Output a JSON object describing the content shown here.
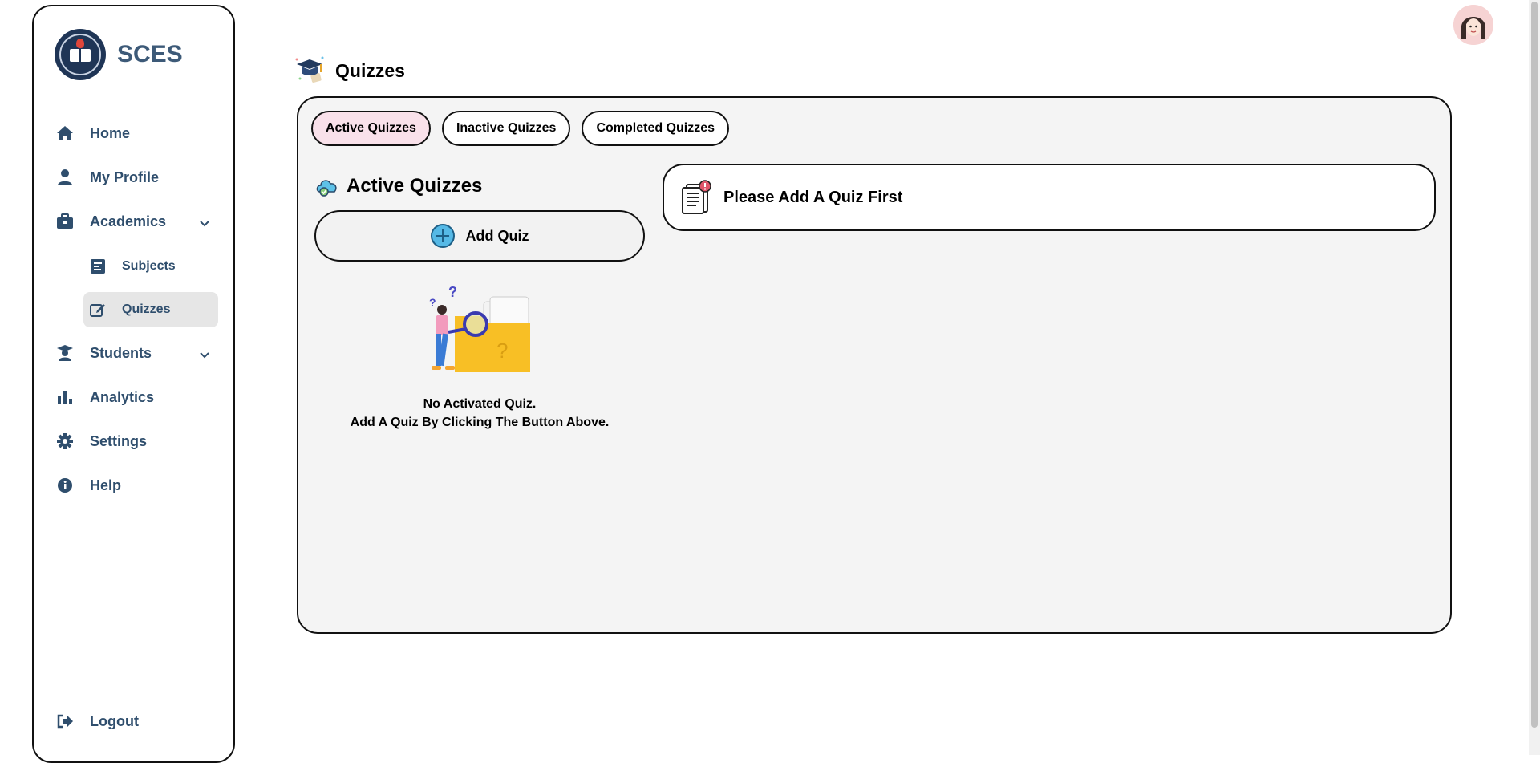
{
  "brand": {
    "name": "SCES"
  },
  "sidebar": {
    "items": [
      {
        "label": "Home",
        "icon": "home-icon"
      },
      {
        "label": "My Profile",
        "icon": "user-icon"
      },
      {
        "label": "Academics",
        "icon": "briefcase-icon",
        "expanded": true,
        "children": [
          {
            "label": "Subjects",
            "icon": "list-icon"
          },
          {
            "label": "Quizzes",
            "icon": "edit-icon",
            "active": true
          }
        ]
      },
      {
        "label": "Students",
        "icon": "graduate-icon"
      },
      {
        "label": "Analytics",
        "icon": "bar-chart-icon"
      },
      {
        "label": "Settings",
        "icon": "gear-icon"
      },
      {
        "label": "Help",
        "icon": "info-icon"
      }
    ],
    "logout": {
      "label": "Logout",
      "icon": "logout-icon"
    }
  },
  "header": {
    "title": "Quizzes"
  },
  "tabs": [
    {
      "label": "Active Quizzes",
      "active": true
    },
    {
      "label": "Inactive Quizzes"
    },
    {
      "label": "Completed Quizzes"
    }
  ],
  "main": {
    "section_title": "Active Quizzes",
    "add_button": "Add Quiz",
    "empty_line1": "No Activated Quiz.",
    "empty_line2": "Add A Quiz By Clicking The Button Above.",
    "notice": "Please Add A Quiz First"
  },
  "colors": {
    "active_tab": "#f9e1ea",
    "nav_text": "#2f4e6d",
    "panel_bg": "#f4f4f4"
  }
}
